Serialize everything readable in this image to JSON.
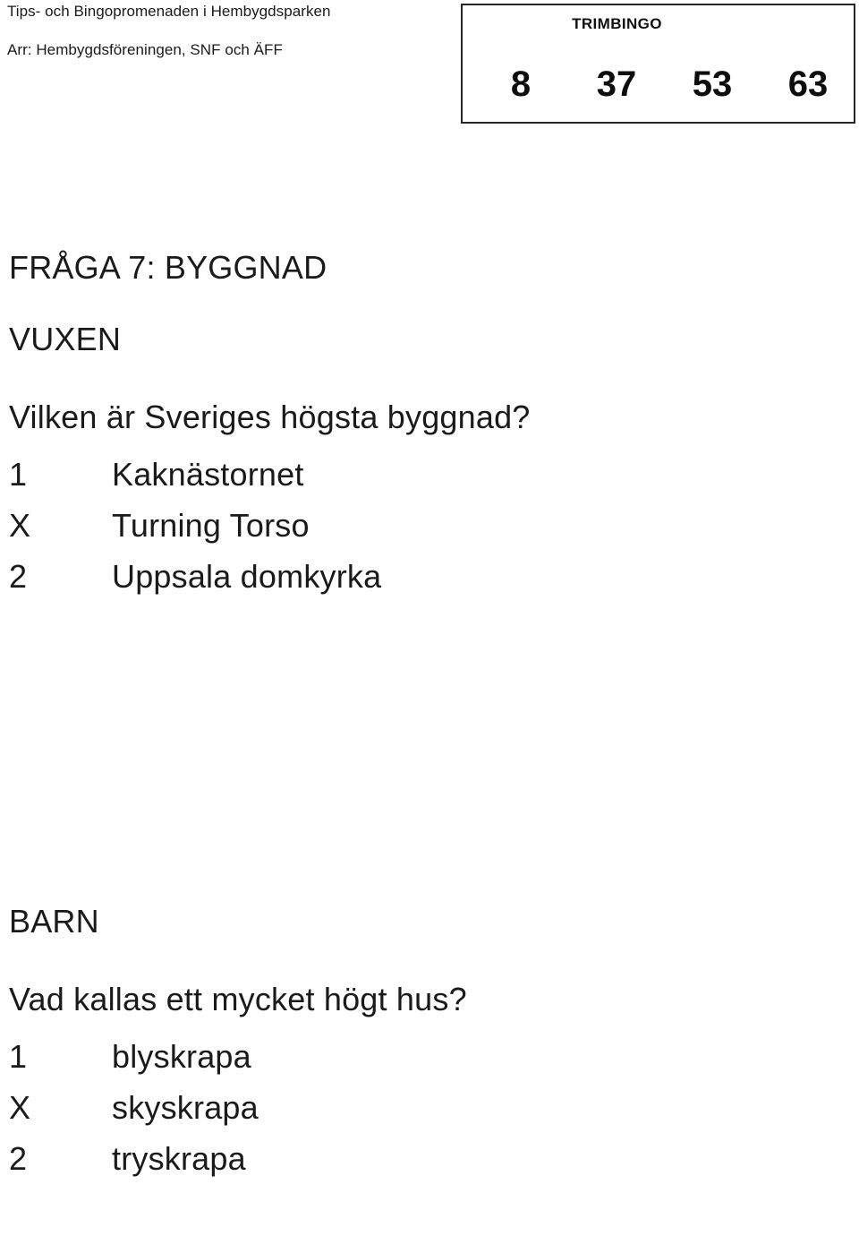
{
  "header": {
    "title_line": "Tips- och Bingopromenaden i Hembygdsparken",
    "arranger_line": "Arr: Hembygdsföreningen, SNF och ÄFF"
  },
  "trimbingo": {
    "label": "TRIMBINGO",
    "numbers": [
      "8",
      "37",
      "53",
      "63"
    ]
  },
  "question": {
    "heading": "FRÅGA 7: BYGGNAD"
  },
  "sections": [
    {
      "label": "VUXEN",
      "question": "Vilken är Sveriges högsta byggnad?",
      "options": [
        {
          "key": "1",
          "text": "Kaknästornet"
        },
        {
          "key": "X",
          "text": "Turning Torso"
        },
        {
          "key": "2",
          "text": "Uppsala domkyrka"
        }
      ]
    },
    {
      "label": "BARN",
      "question": "Vad kallas ett mycket högt hus?",
      "options": [
        {
          "key": "1",
          "text": "blyskrapa"
        },
        {
          "key": "X",
          "text": "skyskrapa"
        },
        {
          "key": "2",
          "text": "tryskrapa"
        }
      ]
    }
  ],
  "colors": {
    "text": "#1a1a1a",
    "box_border": "#262626",
    "page_background": "#ffffff"
  }
}
